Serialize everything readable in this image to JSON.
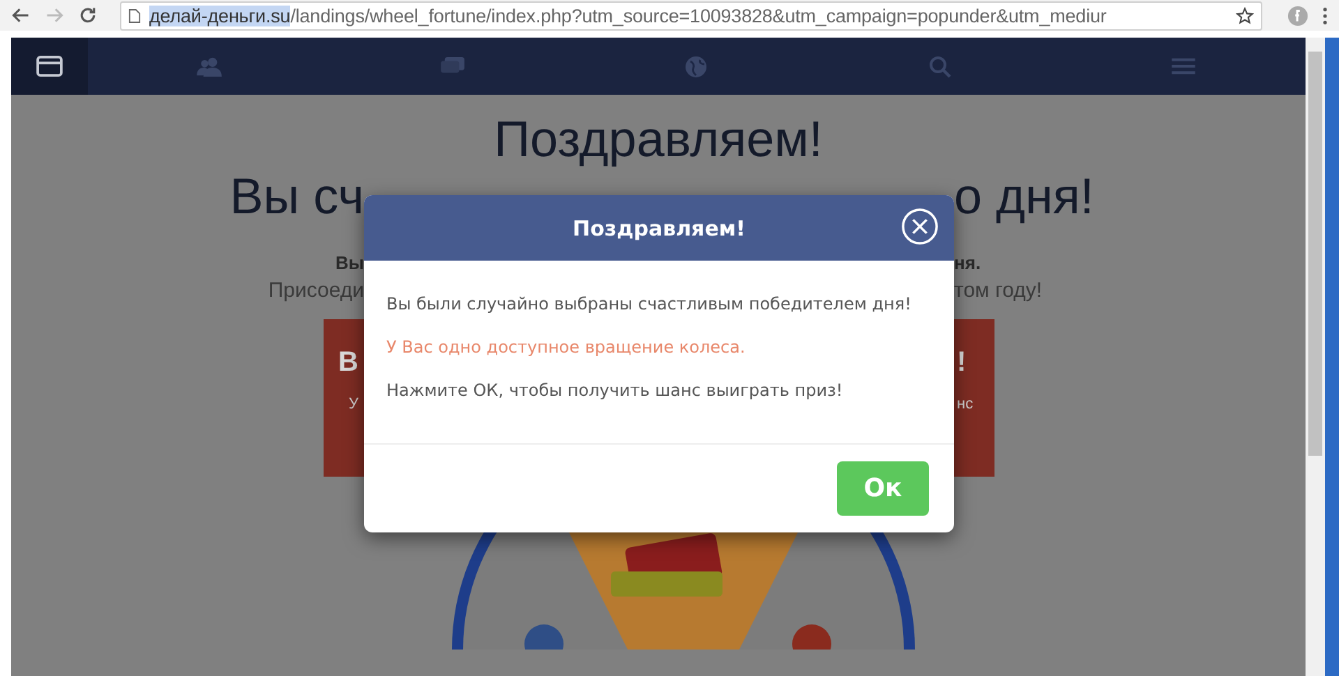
{
  "browser": {
    "url_host": "делай-деньги.su",
    "url_path": "/landings/wheel_fortune/index.php?utm_source=10093828&utm_campaign=popunder&utm_mediur",
    "host_selected": true
  },
  "nav": {
    "items": [
      {
        "kind": "window",
        "selected": true
      },
      {
        "kind": "users",
        "selected": false
      },
      {
        "kind": "chat",
        "selected": false
      },
      {
        "kind": "globe",
        "selected": false
      },
      {
        "kind": "search",
        "selected": false
      },
      {
        "kind": "menu",
        "selected": false
      }
    ]
  },
  "page": {
    "headline": "Поздравляем!",
    "subheadline": {
      "left": "Вы сч",
      "right": "о дня!"
    },
    "lines": [
      {
        "left": "Вы",
        "right": "ня.",
        "bold": true
      },
      {
        "left": "Присоеди",
        "right": "том году!",
        "bold": false
      }
    ],
    "promo_boxes": [
      {
        "title": "В",
        "note": "У"
      },
      {
        "title": "!",
        "note": "нс"
      }
    ]
  },
  "modal": {
    "title": "Поздравляем!",
    "messages": [
      {
        "text": "Вы были случайно выбраны счастливым победителем дня!",
        "kind": "normal"
      },
      {
        "text": "У Вас одно доступное вращение колеса.",
        "kind": "highlight"
      },
      {
        "text": "Нажмите ОК, чтобы получить шанс выиграть приз!",
        "kind": "normal"
      }
    ],
    "button": "Ок"
  }
}
